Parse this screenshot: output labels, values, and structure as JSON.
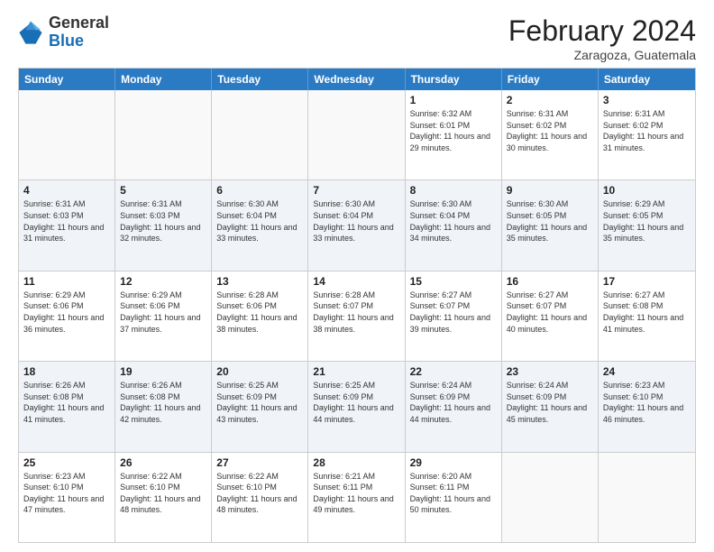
{
  "header": {
    "logo_general": "General",
    "logo_blue": "Blue",
    "month_year": "February 2024",
    "location": "Zaragoza, Guatemala"
  },
  "weekdays": [
    "Sunday",
    "Monday",
    "Tuesday",
    "Wednesday",
    "Thursday",
    "Friday",
    "Saturday"
  ],
  "rows": [
    [
      {
        "day": "",
        "info": ""
      },
      {
        "day": "",
        "info": ""
      },
      {
        "day": "",
        "info": ""
      },
      {
        "day": "",
        "info": ""
      },
      {
        "day": "1",
        "info": "Sunrise: 6:32 AM\nSunset: 6:01 PM\nDaylight: 11 hours and 29 minutes."
      },
      {
        "day": "2",
        "info": "Sunrise: 6:31 AM\nSunset: 6:02 PM\nDaylight: 11 hours and 30 minutes."
      },
      {
        "day": "3",
        "info": "Sunrise: 6:31 AM\nSunset: 6:02 PM\nDaylight: 11 hours and 31 minutes."
      }
    ],
    [
      {
        "day": "4",
        "info": "Sunrise: 6:31 AM\nSunset: 6:03 PM\nDaylight: 11 hours and 31 minutes."
      },
      {
        "day": "5",
        "info": "Sunrise: 6:31 AM\nSunset: 6:03 PM\nDaylight: 11 hours and 32 minutes."
      },
      {
        "day": "6",
        "info": "Sunrise: 6:30 AM\nSunset: 6:04 PM\nDaylight: 11 hours and 33 minutes."
      },
      {
        "day": "7",
        "info": "Sunrise: 6:30 AM\nSunset: 6:04 PM\nDaylight: 11 hours and 33 minutes."
      },
      {
        "day": "8",
        "info": "Sunrise: 6:30 AM\nSunset: 6:04 PM\nDaylight: 11 hours and 34 minutes."
      },
      {
        "day": "9",
        "info": "Sunrise: 6:30 AM\nSunset: 6:05 PM\nDaylight: 11 hours and 35 minutes."
      },
      {
        "day": "10",
        "info": "Sunrise: 6:29 AM\nSunset: 6:05 PM\nDaylight: 11 hours and 35 minutes."
      }
    ],
    [
      {
        "day": "11",
        "info": "Sunrise: 6:29 AM\nSunset: 6:06 PM\nDaylight: 11 hours and 36 minutes."
      },
      {
        "day": "12",
        "info": "Sunrise: 6:29 AM\nSunset: 6:06 PM\nDaylight: 11 hours and 37 minutes."
      },
      {
        "day": "13",
        "info": "Sunrise: 6:28 AM\nSunset: 6:06 PM\nDaylight: 11 hours and 38 minutes."
      },
      {
        "day": "14",
        "info": "Sunrise: 6:28 AM\nSunset: 6:07 PM\nDaylight: 11 hours and 38 minutes."
      },
      {
        "day": "15",
        "info": "Sunrise: 6:27 AM\nSunset: 6:07 PM\nDaylight: 11 hours and 39 minutes."
      },
      {
        "day": "16",
        "info": "Sunrise: 6:27 AM\nSunset: 6:07 PM\nDaylight: 11 hours and 40 minutes."
      },
      {
        "day": "17",
        "info": "Sunrise: 6:27 AM\nSunset: 6:08 PM\nDaylight: 11 hours and 41 minutes."
      }
    ],
    [
      {
        "day": "18",
        "info": "Sunrise: 6:26 AM\nSunset: 6:08 PM\nDaylight: 11 hours and 41 minutes."
      },
      {
        "day": "19",
        "info": "Sunrise: 6:26 AM\nSunset: 6:08 PM\nDaylight: 11 hours and 42 minutes."
      },
      {
        "day": "20",
        "info": "Sunrise: 6:25 AM\nSunset: 6:09 PM\nDaylight: 11 hours and 43 minutes."
      },
      {
        "day": "21",
        "info": "Sunrise: 6:25 AM\nSunset: 6:09 PM\nDaylight: 11 hours and 44 minutes."
      },
      {
        "day": "22",
        "info": "Sunrise: 6:24 AM\nSunset: 6:09 PM\nDaylight: 11 hours and 44 minutes."
      },
      {
        "day": "23",
        "info": "Sunrise: 6:24 AM\nSunset: 6:09 PM\nDaylight: 11 hours and 45 minutes."
      },
      {
        "day": "24",
        "info": "Sunrise: 6:23 AM\nSunset: 6:10 PM\nDaylight: 11 hours and 46 minutes."
      }
    ],
    [
      {
        "day": "25",
        "info": "Sunrise: 6:23 AM\nSunset: 6:10 PM\nDaylight: 11 hours and 47 minutes."
      },
      {
        "day": "26",
        "info": "Sunrise: 6:22 AM\nSunset: 6:10 PM\nDaylight: 11 hours and 48 minutes."
      },
      {
        "day": "27",
        "info": "Sunrise: 6:22 AM\nSunset: 6:10 PM\nDaylight: 11 hours and 48 minutes."
      },
      {
        "day": "28",
        "info": "Sunrise: 6:21 AM\nSunset: 6:11 PM\nDaylight: 11 hours and 49 minutes."
      },
      {
        "day": "29",
        "info": "Sunrise: 6:20 AM\nSunset: 6:11 PM\nDaylight: 11 hours and 50 minutes."
      },
      {
        "day": "",
        "info": ""
      },
      {
        "day": "",
        "info": ""
      }
    ]
  ],
  "alt_rows": [
    1,
    3
  ]
}
